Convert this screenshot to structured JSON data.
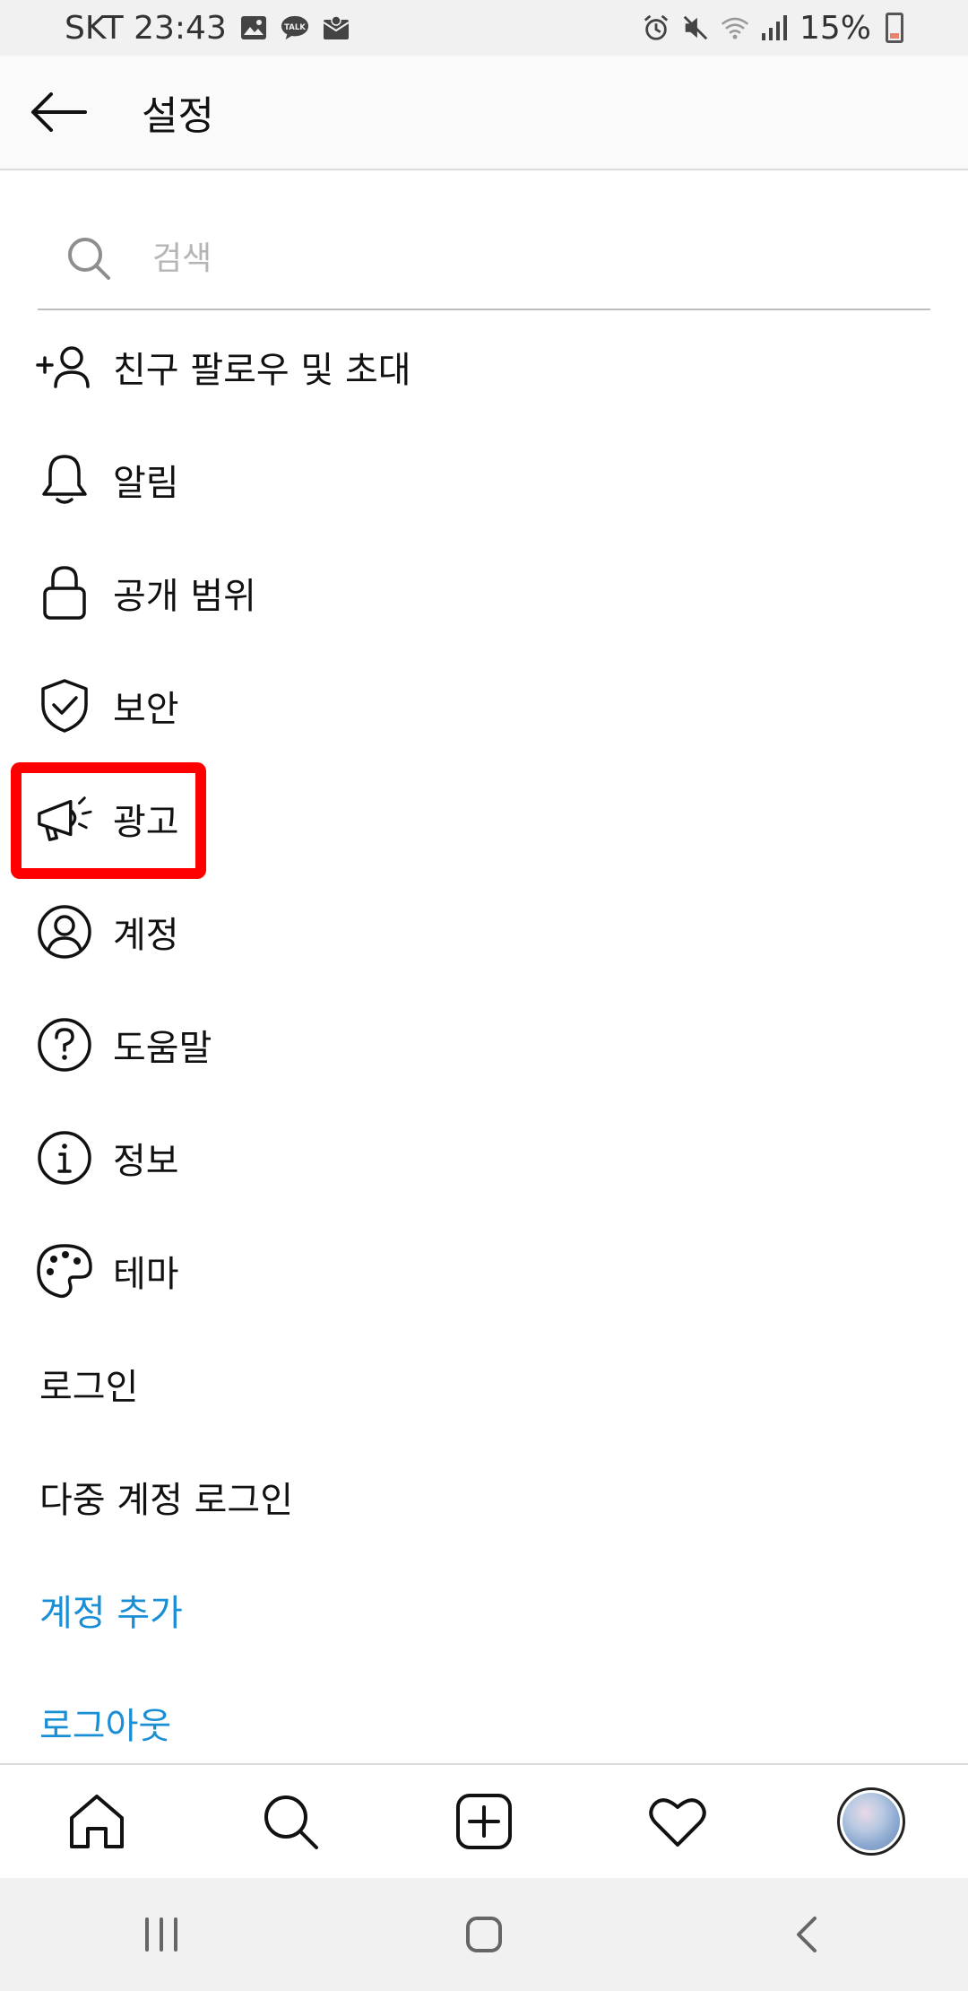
{
  "status_bar": {
    "carrier_time": "SKT 23:43",
    "battery": "15%",
    "left_icons": [
      "gallery-icon",
      "kakaotalk-icon",
      "mail-icon"
    ],
    "right_icons": [
      "alarm-icon",
      "mute-icon",
      "wifi-icon",
      "signal-icon",
      "battery-icon"
    ]
  },
  "header": {
    "title": "설정"
  },
  "search": {
    "placeholder": "검색"
  },
  "menu": {
    "items": [
      {
        "label": "친구 팔로우 및 초대",
        "icon": "add-person-icon"
      },
      {
        "label": "알림",
        "icon": "bell-icon"
      },
      {
        "label": "공개 범위",
        "icon": "lock-icon"
      },
      {
        "label": "보안",
        "icon": "shield-check-icon"
      },
      {
        "label": "광고",
        "icon": "megaphone-icon"
      },
      {
        "label": "계정",
        "icon": "account-icon"
      },
      {
        "label": "도움말",
        "icon": "help-icon"
      },
      {
        "label": "정보",
        "icon": "info-icon"
      },
      {
        "label": "테마",
        "icon": "palette-icon"
      },
      {
        "label": "로그인"
      },
      {
        "label": "다중 계정 로그인"
      },
      {
        "label": "계정 추가"
      },
      {
        "label": "로그아웃"
      }
    ],
    "highlighted_item": "광고"
  },
  "bottom_nav": {
    "items": [
      "home-icon",
      "search-icon",
      "new-post-icon",
      "activity-heart-icon",
      "profile-avatar"
    ]
  },
  "system_nav": {
    "items": [
      "recent-apps-icon",
      "home-button-icon",
      "back-icon"
    ]
  },
  "colors": {
    "link": "#1a8fd6",
    "highlight_box": "#ff0000",
    "status_bar_bg": "#f1f1f1",
    "divider": "#dbdbdb"
  }
}
